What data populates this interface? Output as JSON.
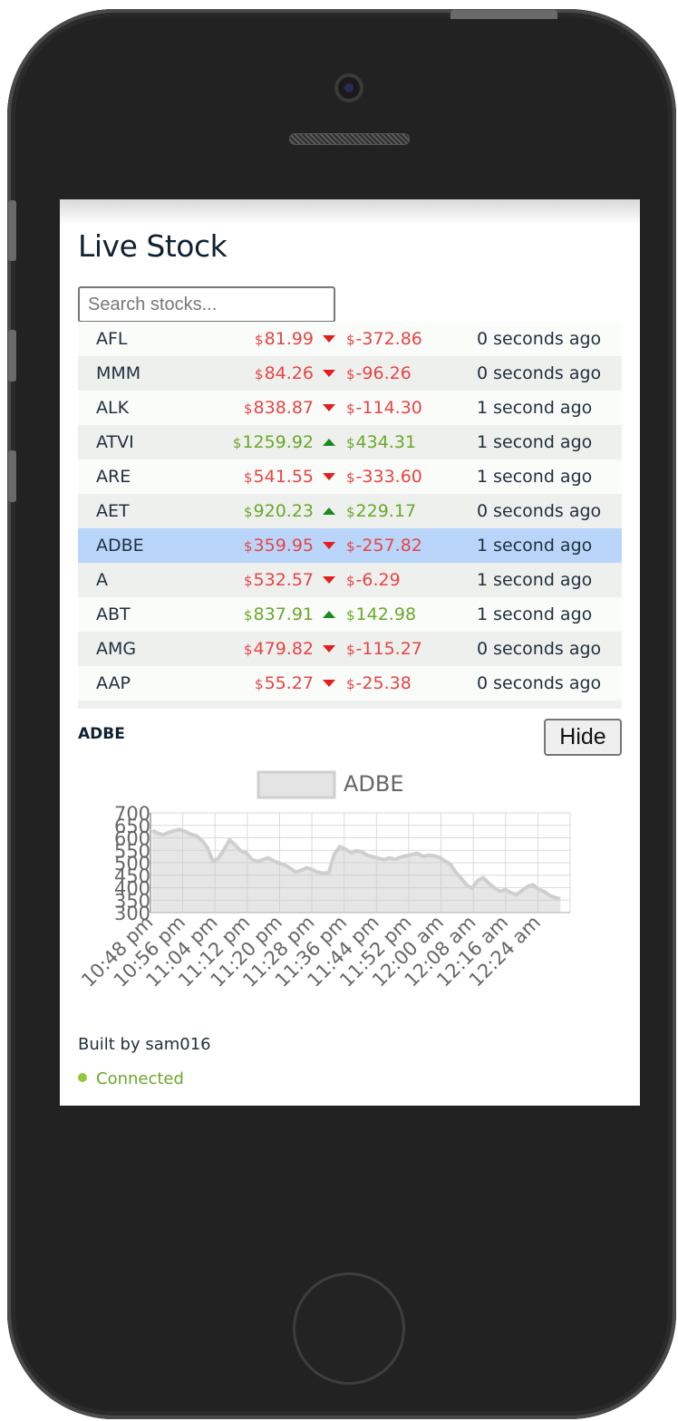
{
  "app": {
    "title": "Live Stock"
  },
  "search": {
    "placeholder": "Search stocks..."
  },
  "currency_symbol": "$",
  "stocks": [
    {
      "symbol": "AFL",
      "price": "81.99",
      "direction": "down",
      "change": "-372.86",
      "updated": "0 seconds ago"
    },
    {
      "symbol": "MMM",
      "price": "84.26",
      "direction": "down",
      "change": "-96.26",
      "updated": "0 seconds ago"
    },
    {
      "symbol": "ALK",
      "price": "838.87",
      "direction": "down",
      "change": "-114.30",
      "updated": "1 second ago"
    },
    {
      "symbol": "ATVI",
      "price": "1259.92",
      "direction": "up",
      "change": "434.31",
      "updated": "1 second ago"
    },
    {
      "symbol": "ARE",
      "price": "541.55",
      "direction": "down",
      "change": "-333.60",
      "updated": "1 second ago"
    },
    {
      "symbol": "AET",
      "price": "920.23",
      "direction": "up",
      "change": "229.17",
      "updated": "0 seconds ago"
    },
    {
      "symbol": "ADBE",
      "price": "359.95",
      "direction": "down",
      "change": "-257.82",
      "updated": "1 second ago",
      "selected": true
    },
    {
      "symbol": "A",
      "price": "532.57",
      "direction": "down",
      "change": "-6.29",
      "updated": "1 second ago"
    },
    {
      "symbol": "ABT",
      "price": "837.91",
      "direction": "up",
      "change": "142.98",
      "updated": "1 second ago"
    },
    {
      "symbol": "AMG",
      "price": "479.82",
      "direction": "down",
      "change": "-115.27",
      "updated": "0 seconds ago"
    },
    {
      "symbol": "AAP",
      "price": "55.27",
      "direction": "down",
      "change": "-25.38",
      "updated": "0 seconds ago"
    },
    {
      "symbol": "",
      "price": "",
      "direction": "",
      "change": "",
      "updated": ""
    }
  ],
  "detail": {
    "symbol": "ADBE",
    "hide_label": "Hide"
  },
  "chart_data": {
    "type": "area",
    "legend": [
      "ADBE"
    ],
    "legend_position": "top",
    "grid": true,
    "ylim": [
      300,
      700
    ],
    "yticks": [
      "300",
      "350",
      "400",
      "450",
      "500",
      "550",
      "600",
      "650",
      "700"
    ],
    "xticks": [
      "10:48 pm",
      "10:56 pm",
      "11:04 pm",
      "11:12 pm",
      "11:20 pm",
      "11:28 pm",
      "11:36 pm",
      "11:44 pm",
      "11:52 pm",
      "12:00 am",
      "12:08 am",
      "12:16 am",
      "12:24 am"
    ],
    "series": [
      {
        "name": "ADBE",
        "values": [
          630,
          618,
          612,
          622,
          628,
          634,
          625,
          614,
          608,
          590,
          560,
          505,
          518,
          552,
          592,
          572,
          548,
          540,
          515,
          505,
          512,
          520,
          508,
          498,
          492,
          478,
          462,
          470,
          480,
          472,
          462,
          458,
          460,
          535,
          565,
          555,
          540,
          548,
          544,
          530,
          524,
          518,
          512,
          520,
          514,
          522,
          528,
          532,
          538,
          526,
          530,
          528,
          522,
          508,
          495,
          462,
          438,
          410,
          398,
          428,
          440,
          418,
          400,
          385,
          392,
          380,
          372,
          388,
          404,
          412,
          394,
          385,
          370,
          360,
          355
        ]
      }
    ]
  },
  "footer": {
    "built_by": "Built by sam016"
  },
  "status": {
    "label": "Connected",
    "color": "#8fc83a"
  }
}
